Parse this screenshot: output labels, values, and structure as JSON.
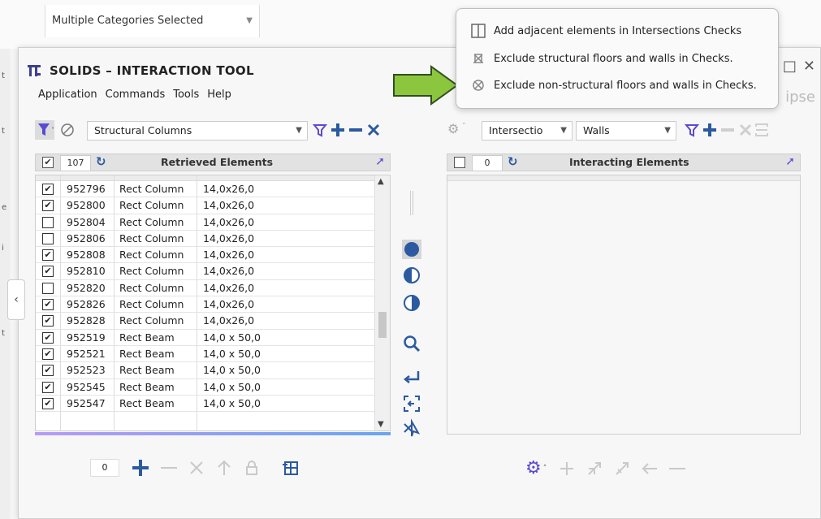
{
  "background": {
    "dropdown_value": "Multiple Categories Selected",
    "side_letters": [
      "t",
      "t",
      "e",
      "i",
      "t"
    ],
    "collapse_glyph": "‹",
    "ghost_text": "ipse"
  },
  "window": {
    "title": "SOLIDS – INTERACTION TOOL",
    "menu": [
      "Application",
      "Commands",
      "Tools",
      "Help"
    ],
    "buttons": {
      "minimize": "□",
      "close": "✕"
    }
  },
  "left": {
    "category_combo": "Structural Columns",
    "header": {
      "count": "107",
      "title": "Retrieved Elements",
      "checked": true
    },
    "rows": [
      {
        "checked": true,
        "id": "952796",
        "name": "Rect Column",
        "size": "14,0x26,0"
      },
      {
        "checked": true,
        "id": "952800",
        "name": "Rect Column",
        "size": "14,0x26,0"
      },
      {
        "checked": false,
        "id": "952804",
        "name": "Rect Column",
        "size": "14,0x26,0"
      },
      {
        "checked": false,
        "id": "952806",
        "name": "Rect Column",
        "size": "14,0x26,0"
      },
      {
        "checked": true,
        "id": "952808",
        "name": "Rect Column",
        "size": "14,0x26,0"
      },
      {
        "checked": true,
        "id": "952810",
        "name": "Rect Column",
        "size": "14,0x26,0"
      },
      {
        "checked": false,
        "id": "952820",
        "name": "Rect Column",
        "size": "14,0x26,0"
      },
      {
        "checked": true,
        "id": "952826",
        "name": "Rect Column",
        "size": "14,0x26,0"
      },
      {
        "checked": true,
        "id": "952828",
        "name": "Rect Column",
        "size": "14,0x26,0"
      },
      {
        "checked": true,
        "id": "952519",
        "name": "Rect Beam",
        "size": "14,0 x 50,0"
      },
      {
        "checked": true,
        "id": "952521",
        "name": "Rect Beam",
        "size": "14,0 x 50,0"
      },
      {
        "checked": true,
        "id": "952523",
        "name": "Rect Beam",
        "size": "14,0 x 50,0"
      },
      {
        "checked": true,
        "id": "952545",
        "name": "Rect Beam",
        "size": "14,0 x 50,0"
      },
      {
        "checked": true,
        "id": "952547",
        "name": "Rect Beam",
        "size": "14,0 x 50,0"
      }
    ],
    "bottom_count": "0"
  },
  "right": {
    "mode_combo": "Intersectio",
    "category_combo": "Walls",
    "header": {
      "count": "0",
      "title": "Interacting Elements",
      "checked": false
    }
  },
  "popup": {
    "items": [
      "Add adjacent elements in Intersections Checks",
      "Exclude structural floors and walls in Checks.",
      "Exclude non-structural floors and walls in Checks."
    ]
  },
  "colors": {
    "accent_purple": "#5a4bd1",
    "accent_blue": "#2c5aa0",
    "arrow_green": "#8cc63f"
  }
}
